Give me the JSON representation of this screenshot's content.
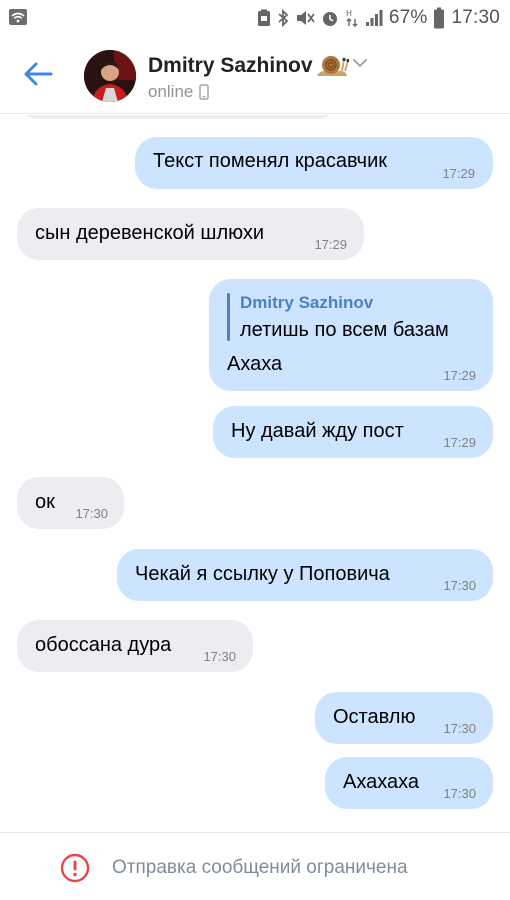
{
  "status_bar": {
    "battery_percent": "67%",
    "time": "17:30",
    "icons": [
      "wifi-icon",
      "screenshot-icon",
      "bluetooth-icon",
      "mute-icon",
      "alarm-icon",
      "data-icon",
      "signal-icon",
      "battery-icon"
    ]
  },
  "header": {
    "name": "Dmitry Sazhinov",
    "status": "online",
    "icons": [
      "back-arrow-icon",
      "snail-emoji-icon",
      "chevron-down-icon",
      "mobile-phone-icon"
    ],
    "accent_color": "#3f8ae0"
  },
  "messages": [
    {
      "direction": "out",
      "text": "Текст поменял красавчик",
      "time": "17:29"
    },
    {
      "direction": "in",
      "text": "сын деревенской шлюхи",
      "time": "17:29"
    },
    {
      "direction": "out",
      "reply_name": "Dmitry Sazhinov",
      "reply_text": "летишь по всем базам",
      "text": "Ахаха",
      "time": "17:29"
    },
    {
      "direction": "out",
      "text": "Ну давай жду пост",
      "time": "17:29"
    },
    {
      "direction": "in",
      "text": "ок",
      "time": "17:30"
    },
    {
      "direction": "out",
      "text": "Чекай я ссылку у Поповича",
      "time": "17:30"
    },
    {
      "direction": "in",
      "text": "обоссана дура",
      "time": "17:30"
    },
    {
      "direction": "out",
      "text": "Оставлю",
      "time": "17:30"
    },
    {
      "direction": "out",
      "text": "Ахахаха",
      "time": "17:30"
    }
  ],
  "footer": {
    "notice": "Отправка сообщений ограничена",
    "icon": "warning-circle-icon",
    "icon_color": "#e64646"
  },
  "colors": {
    "outgoing_bubble": "#cce4ff",
    "incoming_bubble": "#ebedf0",
    "reply_name": "#4a82c1"
  }
}
